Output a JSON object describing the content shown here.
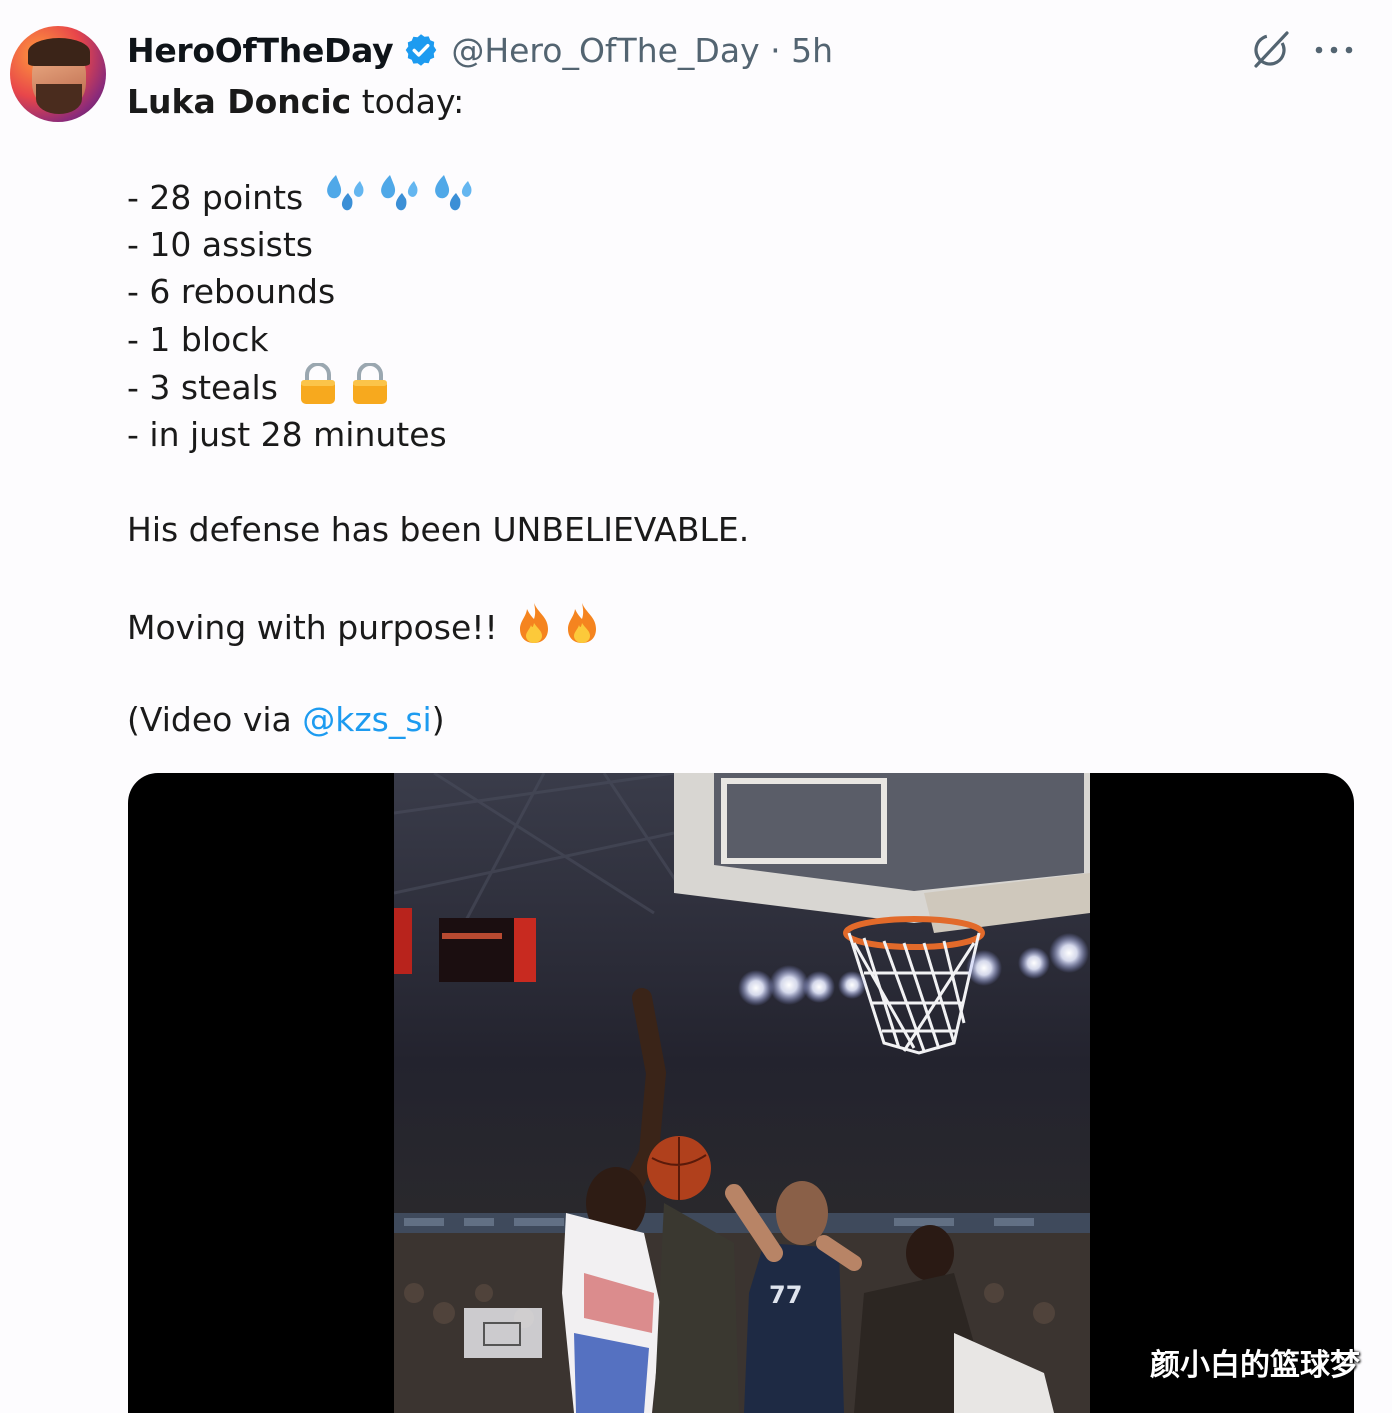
{
  "post": {
    "display_name": "HeroOfTheDay",
    "handle": "@Hero_OfThe_Day",
    "separator": "·",
    "time": "5h",
    "verified_color": "#1d9bf0",
    "icons": [
      "grok-icon",
      "more-icon",
      "verified-badge-icon"
    ],
    "text": {
      "intro_bold": "Luka Doncic",
      "intro_rest": " today:",
      "stats": [
        "- 28 points",
        "- 10 assists",
        "- 6 rebounds",
        "- 1 block",
        "- 3 steals",
        "- in just 28 minutes"
      ],
      "defense": "His defense has been UNBELIEVABLE.",
      "moving": "Moving with purpose!!",
      "credit_prefix": "(Video via ",
      "credit_mention": "@kzs_si",
      "credit_suffix": ")"
    },
    "emojis": {
      "points": [
        "sweat-droplets-emoji",
        "sweat-droplets-emoji",
        "sweat-droplets-emoji"
      ],
      "steals": [
        "lock-emoji",
        "lock-emoji"
      ],
      "moving": [
        "fire-emoji",
        "fire-emoji"
      ]
    },
    "link_color": "#1d9bf0"
  },
  "media": {
    "type": "video",
    "jersey_number": "77"
  },
  "watermark": "颜小白的篮球梦"
}
